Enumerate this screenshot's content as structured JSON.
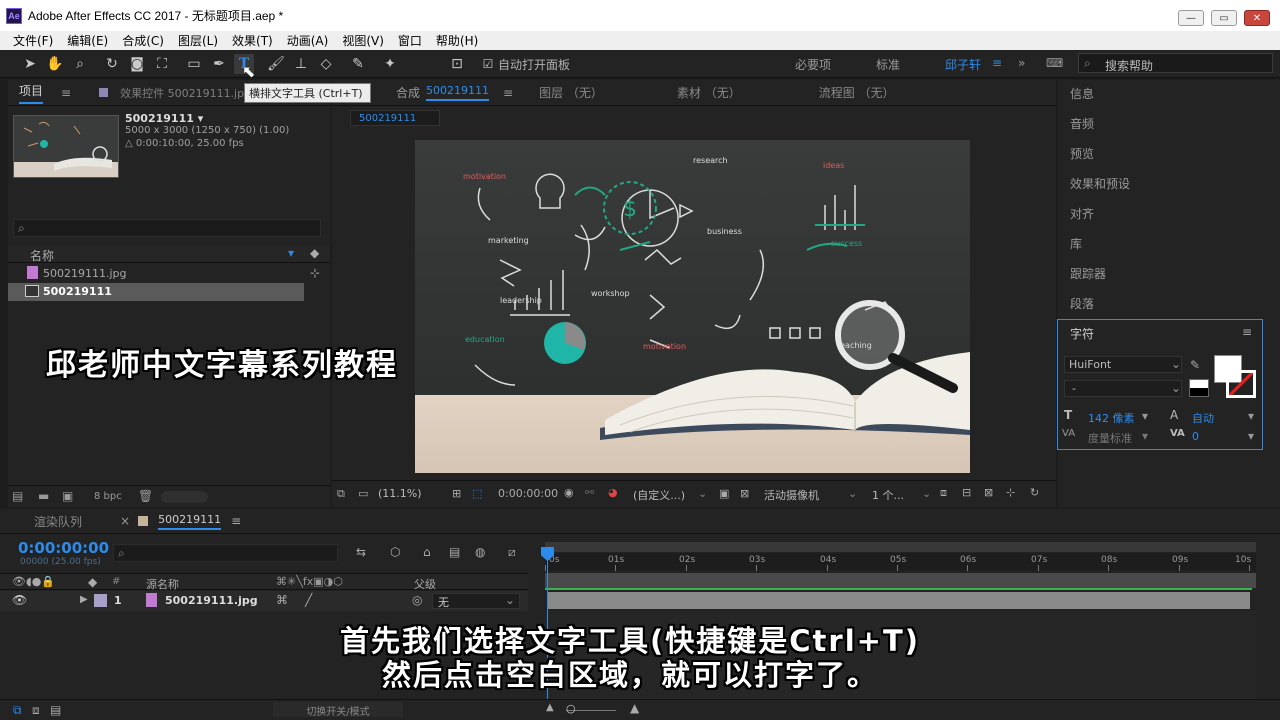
{
  "window": {
    "title": "Adobe After Effects CC 2017 - 无标题项目.aep *",
    "logo": "Ae",
    "min_icon": "minimize-icon",
    "max_icon": "maximize-icon",
    "close_icon": "close-icon"
  },
  "menu": [
    "文件(F)",
    "编辑(E)",
    "合成(C)",
    "图层(L)",
    "效果(T)",
    "动画(A)",
    "视图(V)",
    "窗口",
    "帮助(H)"
  ],
  "toolbar": {
    "auto_open": "自动打开面板",
    "ws_essentials": "必要项",
    "ws_standard": "标准",
    "ws_user": "邱子轩",
    "search_placeholder": "搜索帮助",
    "tooltip": "横排文字工具 (Ctrl+T)"
  },
  "project": {
    "tab": "项目",
    "effects_tab": "效果控件 500219111.jpg",
    "item_name": "500219111 ▾",
    "item_dims": "5000 x 3000  (1250 x 750) (1.00)",
    "item_time": "△ 0:00:10:00, 25.00 fps",
    "col_name": "名称",
    "files": [
      "500219111.jpg",
      "500219111"
    ],
    "bpc": "8 bpc"
  },
  "comp": {
    "tab": "合成",
    "tab_name": "500219111",
    "layer_tab": "图层 （无）",
    "footage_tab": "素材 （无）",
    "flow_tab": "流程图 （无）",
    "crumb": "500219111",
    "zoom": "(11.1%)",
    "time": "0:00:00:00",
    "view": "(自定义...)",
    "camera": "活动摄像机",
    "views": "1 个...",
    "chalk": {
      "motivation": "motivation",
      "research": "research",
      "ideas": "ideas",
      "marketing": "marketing",
      "business": "business",
      "success": "success",
      "leadership": "leadership",
      "workshop": "workshop",
      "education": "education",
      "teaching": "teaching"
    }
  },
  "right": {
    "items": [
      "信息",
      "音频",
      "预览",
      "效果和预设",
      "对齐",
      "库",
      "跟踪器",
      "段落"
    ],
    "char_title": "字符",
    "font": "HuiFont",
    "style": "-",
    "size": "142 像素",
    "leading": "自动",
    "kerning": "度量标准",
    "tracking": "0"
  },
  "timeline": {
    "render_tab": "渲染队列",
    "comp_tab": "500219111",
    "timecode": "0:00:00:00",
    "frames": "00000 (25.00 fps)",
    "col_src": "源名称",
    "col_parent": "父级",
    "layer_num": "1",
    "layer_name": "500219111.jpg",
    "parent_val": "无",
    "toggle": "切换开关/模式",
    "ticks": [
      "0s",
      "01s",
      "02s",
      "03s",
      "04s",
      "05s",
      "06s",
      "07s",
      "08s",
      "09s",
      "10s"
    ]
  },
  "subtitles": {
    "title": "邱老师中文字幕系列教程",
    "line1": "首先我们选择文字工具(快捷键是Ctrl+T)",
    "line2": "然后点击空白区域，就可以打字了。"
  }
}
